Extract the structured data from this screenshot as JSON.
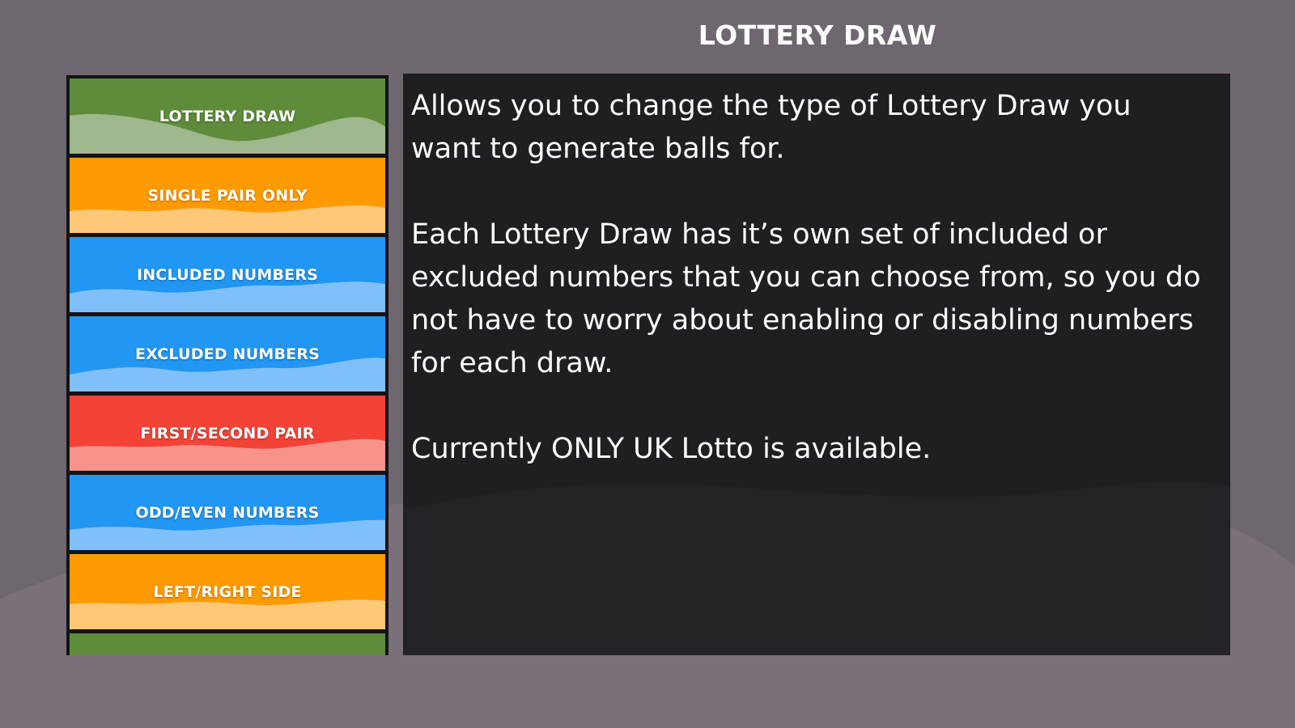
{
  "page": {
    "title": "LOTTERY DRAW",
    "background_color": "#6e6770"
  },
  "menu": {
    "items": [
      {
        "label": "LOTTERY DRAW",
        "color": "#5e8c3a",
        "wave_color": "#9fb88e"
      },
      {
        "label": "SINGLE PAIR ONLY",
        "color": "#ff9a00",
        "wave_color": "#ffc877"
      },
      {
        "label": "INCLUDED NUMBERS",
        "color": "#2196f3",
        "wave_color": "#7fc0fb"
      },
      {
        "label": "EXCLUDED NUMBERS",
        "color": "#2196f3",
        "wave_color": "#7fc0fb"
      },
      {
        "label": "FIRST/SECOND PAIR",
        "color": "#f44336",
        "wave_color": "#f8938a"
      },
      {
        "label": "ODD/EVEN NUMBERS",
        "color": "#2196f3",
        "wave_color": "#7fc0fb"
      },
      {
        "label": "LEFT/RIGHT SIDE",
        "color": "#ff9a00",
        "wave_color": "#ffc877"
      },
      {
        "label": "",
        "color": "#5e8c3a",
        "wave_color": "#9fb88e"
      }
    ]
  },
  "description": {
    "paragraphs": [
      "Allows you to change the type of Lottery Draw you want to generate balls for.",
      "Each Lottery Draw has it’s own set of included or excluded numbers that you can choose from, so you do not have to worry about enabling or disabling numbers for each draw.",
      "Currently ONLY UK Lotto is available."
    ]
  }
}
